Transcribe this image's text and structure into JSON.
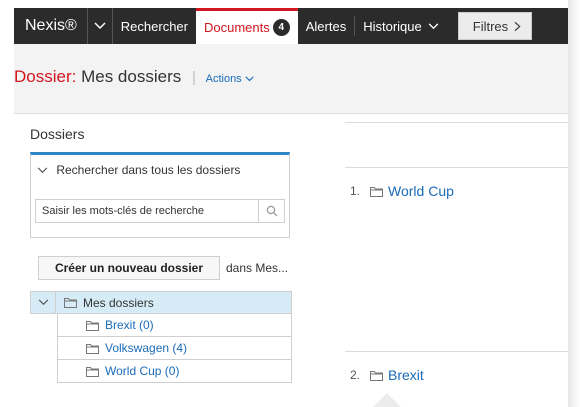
{
  "nav": {
    "brand": "Nexis®",
    "items": [
      "Rechercher",
      "Documents",
      "Alertes",
      "Historique"
    ],
    "documents_count": "4",
    "filtres": "Filtres"
  },
  "header": {
    "title_label": "Dossier:",
    "title_value": "Mes dossiers",
    "actions": "Actions"
  },
  "panel": {
    "title": "Dossiers",
    "search_toggle": "Rechercher dans tous les dossiers",
    "search_placeholder": "Saisir les mots-clés de recherche",
    "create_button": "Créer un nouveau dossier",
    "create_suffix": "dans Mes..."
  },
  "tree": {
    "root": "Mes dossiers",
    "children": [
      "Brexit (0)",
      "Volkswagen (4)",
      "World Cup (0)"
    ]
  },
  "results": [
    {
      "num": "1.",
      "name": "World Cup"
    },
    {
      "num": "2.",
      "name": "Brexit"
    }
  ],
  "icons": [
    "chevron-down-icon",
    "chevron-right-icon",
    "search-icon",
    "folder-icon"
  ],
  "colors": {
    "nav_bg": "#2b2b2b",
    "accent_red": "#d0171f",
    "link_blue": "#1a6bb8",
    "tree_selected": "#d5ecf6"
  }
}
